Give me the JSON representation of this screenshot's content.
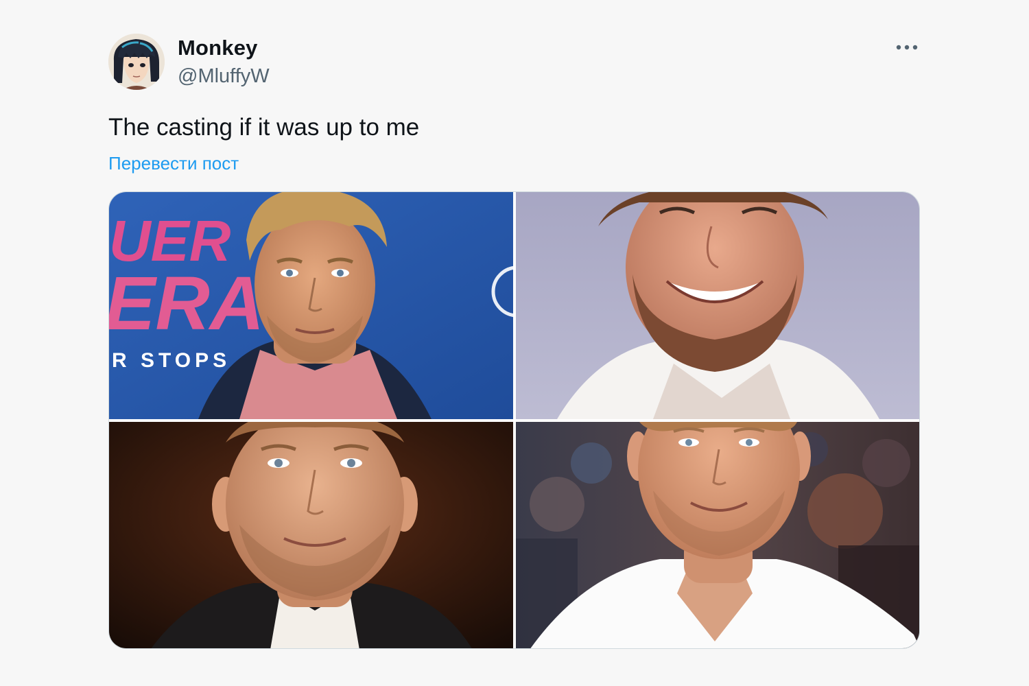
{
  "author": {
    "display_name": "Monkey",
    "handle": "@MluffyW",
    "avatar_icon": "anime-character-avatar"
  },
  "tweet": {
    "text": "The casting if it was up to me",
    "translate_label": "Перевести пост"
  },
  "menu": {
    "more_icon": "more-horizontal-icon"
  },
  "media": {
    "photos": [
      {
        "description": "man-portrait-blue-backdrop",
        "backdrop_text_1": "UER",
        "backdrop_text_2": "ERA",
        "backdrop_text_3": "R STOPS"
      },
      {
        "description": "man-smiling-white-collar"
      },
      {
        "description": "man-portrait-dark-background"
      },
      {
        "description": "man-smiling-white-shirt-crowd"
      }
    ]
  },
  "colors": {
    "background": "#f7f7f7",
    "text": "#0f1419",
    "secondary_text": "#536471",
    "link": "#1d9bf0",
    "border": "#cfd9de"
  }
}
